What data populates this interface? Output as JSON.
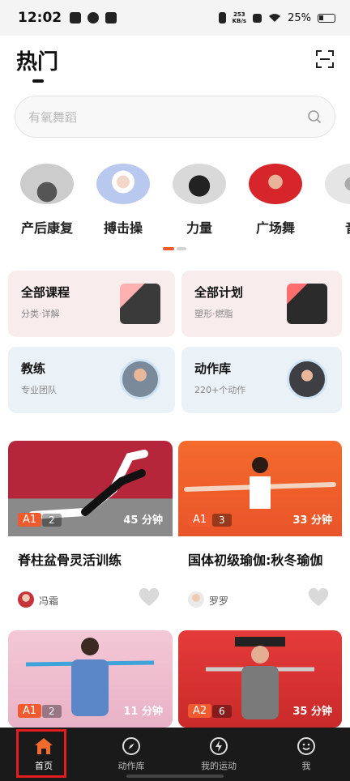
{
  "status": {
    "time": "12:02",
    "net_rate": "253",
    "net_unit": "KB/s",
    "battery": "25%"
  },
  "header": {
    "title": "热门",
    "scan_icon": "scan-icon"
  },
  "search": {
    "placeholder": "有氧舞蹈",
    "icon": "search-icon"
  },
  "categories": [
    {
      "label": "产后康复"
    },
    {
      "label": "搏击操"
    },
    {
      "label": "力量"
    },
    {
      "label": "广场舞"
    },
    {
      "label": "音"
    }
  ],
  "quick": [
    {
      "title": "全部课程",
      "sub": "分类·详解"
    },
    {
      "title": "全部计划",
      "sub": "塑形·燃脂"
    },
    {
      "title": "教练",
      "sub": "专业团队"
    },
    {
      "title": "动作库",
      "sub": "220+个动作"
    }
  ],
  "courses": [
    {
      "level": "A1",
      "people": "2",
      "duration": "45 分钟",
      "title": "脊柱盆骨灵活训练",
      "coach": "冯霜"
    },
    {
      "level": "A1",
      "people": "3",
      "duration": "33 分钟",
      "title": "国体初级瑜伽:秋冬瑜伽",
      "coach": "罗罗"
    },
    {
      "level": "A1",
      "people": "2",
      "duration": "11 分钟"
    },
    {
      "level": "A2",
      "people": "6",
      "duration": "35 分钟"
    }
  ],
  "nav": [
    {
      "label": "首页",
      "icon": "home-icon"
    },
    {
      "label": "动作库",
      "icon": "compass-icon"
    },
    {
      "label": "我的运动",
      "icon": "lightning-icon"
    },
    {
      "label": "我",
      "icon": "smiley-icon"
    }
  ],
  "colors": {
    "accent": "#ef5b2e",
    "nav_bg": "#1a1a1a",
    "highlight": "#e21d1d"
  }
}
